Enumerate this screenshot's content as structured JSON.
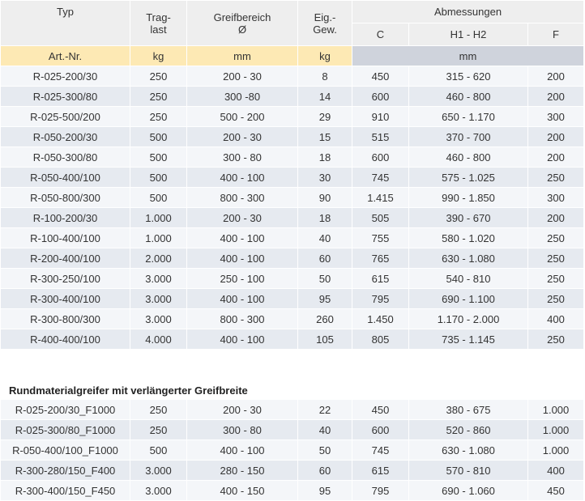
{
  "header": {
    "typ": "Typ",
    "traglast_1": "Trag-",
    "traglast_2": "last",
    "greifbereich_1": "Greifbereich",
    "greifbereich_2": "Ø",
    "eigengewicht_1": "Eig.-",
    "eigengewicht_2": "Gew.",
    "abmessungen": "Abmessungen",
    "c": "C",
    "h1h2": "H1 - H2",
    "f": "F"
  },
  "units": {
    "artnr": "Art.-Nr.",
    "kg": "kg",
    "mm": "mm",
    "kg2": "kg",
    "mm2": "mm"
  },
  "rows": [
    [
      "R-025-200/30",
      "250",
      "200 - 30",
      "8",
      "450",
      "315 - 620",
      "200"
    ],
    [
      "R-025-300/80",
      "250",
      "300 -80",
      "14",
      "600",
      "460 - 800",
      "200"
    ],
    [
      "R-025-500/200",
      "250",
      "500 - 200",
      "29",
      "910",
      "650 - 1.170",
      "300"
    ],
    [
      "R-050-200/30",
      "500",
      "200 - 30",
      "15",
      "515",
      "370 - 700",
      "200"
    ],
    [
      "R-050-300/80",
      "500",
      "300 - 80",
      "18",
      "600",
      "460 - 800",
      "200"
    ],
    [
      "R-050-400/100",
      "500",
      "400 - 100",
      "30",
      "745",
      "575 - 1.025",
      "250"
    ],
    [
      "R-050-800/300",
      "500",
      "800 - 300",
      "90",
      "1.415",
      "990 - 1.850",
      "300"
    ],
    [
      "R-100-200/30",
      "1.000",
      "200 - 30",
      "18",
      "505",
      "390 - 670",
      "200"
    ],
    [
      "R-100-400/100",
      "1.000",
      "400 - 100",
      "40",
      "755",
      "580 - 1.020",
      "250"
    ],
    [
      "R-200-400/100",
      "2.000",
      "400 - 100",
      "60",
      "765",
      "630 - 1.080",
      "250"
    ],
    [
      "R-300-250/100",
      "3.000",
      "250 - 100",
      "50",
      "615",
      "540 - 810",
      "250"
    ],
    [
      "R-300-400/100",
      "3.000",
      "400 - 100",
      "95",
      "795",
      "690 - 1.100",
      "250"
    ],
    [
      "R-300-800/300",
      "3.000",
      "800 - 300",
      "260",
      "1.450",
      "1.170 - 2.000",
      "400"
    ],
    [
      "R-400-400/100",
      "4.000",
      "400 - 100",
      "105",
      "805",
      "735 - 1.145",
      "250"
    ]
  ],
  "section_title": "Rundmaterialgreifer mit verlängerter Greifbreite",
  "rows2": [
    [
      "R-025-200/30_F1000",
      "250",
      "200 - 30",
      "22",
      "450",
      "380 - 675",
      "1.000"
    ],
    [
      "R-025-300/80_F1000",
      "250",
      "300 - 80",
      "40",
      "600",
      "520 - 860",
      "1.000"
    ],
    [
      "R-050-400/100_F1000",
      "500",
      "400 - 100",
      "50",
      "745",
      "630 - 1.080",
      "1.000"
    ],
    [
      "R-300-280/150_F400",
      "3.000",
      "280 - 150",
      "60",
      "615",
      "570 - 810",
      "400"
    ],
    [
      "R-300-400/150_F450",
      "3.000",
      "400 - 150",
      "95",
      "795",
      "690 - 1.060",
      "450"
    ]
  ]
}
